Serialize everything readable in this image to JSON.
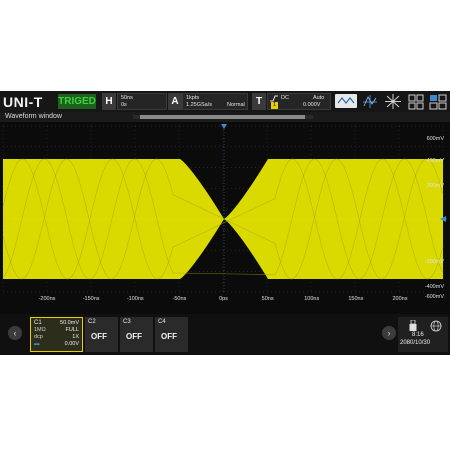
{
  "header": {
    "brand": "UNI-T",
    "trigger_status": "TRIGED",
    "horizontal": {
      "key": "H",
      "timebase": "50ns",
      "offset": "0s"
    },
    "acquire": {
      "key": "A",
      "memory_depth": "1kpts",
      "sample_rate": "1.25GSa/s",
      "mode": "Normal"
    },
    "trigger": {
      "key": "T",
      "coupling": "DC",
      "source": "1",
      "sweep": "Auto",
      "level": "0.000V"
    },
    "icons": [
      "trigger-edge-icon",
      "measure-icon",
      "cursor-icon",
      "close-grid-icon",
      "layout-icon"
    ]
  },
  "window": {
    "title": "Waveform window"
  },
  "axes": {
    "y_labels": [
      "600mV",
      "400mV",
      "200mV",
      "-200mV",
      "-400mV",
      "-600mV"
    ],
    "x_labels": [
      "-200ns",
      "-150ns",
      "-100ns",
      "-50ns",
      "0ps",
      "50ns",
      "100ns",
      "150ns",
      "200ns"
    ],
    "ch1_marker": "1"
  },
  "channels": {
    "c1": {
      "name": "C1",
      "scale": "50.0mV",
      "impedance": "1MΩ",
      "bandwidth": "FULL",
      "coupling": "dcp",
      "probe": "1X",
      "offset": "0.00V"
    },
    "c2": {
      "name": "C2",
      "state": "OFF"
    },
    "c3": {
      "name": "C3",
      "state": "OFF"
    },
    "c4": {
      "name": "C4",
      "state": "OFF"
    }
  },
  "status": {
    "time": "8:16",
    "date": "2080/10/30",
    "icons": [
      "usb-icon",
      "network-icon"
    ]
  },
  "colors": {
    "trace": "#e6e600",
    "background": "#0b0b0b",
    "trig_green": "#39d339",
    "accent_blue": "#3a8bd6"
  }
}
